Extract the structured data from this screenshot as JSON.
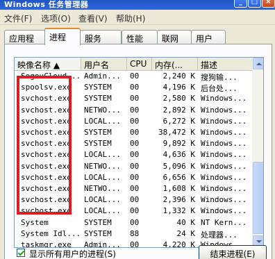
{
  "window": {
    "title": "Windows 任务管理器",
    "buttons": {
      "min": "_",
      "max": "□",
      "close": "×"
    }
  },
  "menu": [
    "文件(F)",
    "选项(O)",
    "查看(V)",
    "帮助(H)"
  ],
  "tabs": [
    {
      "label": "应用程序",
      "active": false
    },
    {
      "label": "进程",
      "active": true
    },
    {
      "label": "服务",
      "active": false
    },
    {
      "label": "性能",
      "active": false
    },
    {
      "label": "联网",
      "active": false
    },
    {
      "label": "用户",
      "active": false
    }
  ],
  "list": {
    "columns": [
      "映像名称 ▲",
      "用户名",
      "CPU",
      "内存(...",
      "描述"
    ],
    "rows": [
      [
        "SogouCloud...",
        "Admin...",
        "00",
        "2,240 K",
        "搜狗输..."
      ],
      [
        "spoolsv.exe",
        "SYSTEM",
        "00",
        "4,196 K",
        "后台处..."
      ],
      [
        "svchost.exe",
        "SYSTEM",
        "00",
        "2,580 K",
        "Windows..."
      ],
      [
        "svchost.exe",
        "NETWO...",
        "00",
        "2,892 K",
        "Windows..."
      ],
      [
        "svchost.exe",
        "LOCAL...",
        "00",
        "6,272 K",
        "Windows..."
      ],
      [
        "svchost.exe",
        "SYSTEM",
        "00",
        "38,472 K",
        "Windows..."
      ],
      [
        "svchost.exe",
        "SYSTEM",
        "00",
        "9,892 K",
        "Windows..."
      ],
      [
        "svchost.exe",
        "LOCAL...",
        "00",
        "4,636 K",
        "Windows..."
      ],
      [
        "svchost.exe",
        "NETWO...",
        "00",
        "5,096 K",
        "Windows..."
      ],
      [
        "svchost.exe",
        "LOCAL...",
        "00",
        "6,656 K",
        "Windows..."
      ],
      [
        "svchost.exe",
        "NETWO...",
        "00",
        "1,608 K",
        "Windows..."
      ],
      [
        "svchost.exe",
        "LOCAL...",
        "00",
        "2,396 K",
        "Windows..."
      ],
      [
        "svchost.exe",
        "LOCAL...",
        "00",
        "1,332 K",
        "Windows..."
      ],
      [
        "System",
        "SYSTEM",
        "00",
        "40 K",
        "NT Kern..."
      ],
      [
        "System Idl...",
        "SYSTEM",
        "88",
        "24 K",
        "处理器..."
      ],
      [
        "taskmgr.exe",
        "Admin...",
        "00",
        "4,220 K",
        "Windows..."
      ]
    ]
  },
  "footer": {
    "show_all_label": "显示所有用户的进程(S)",
    "show_all_checked": true,
    "end_process_label": "结束进程(E)"
  },
  "colors": {
    "highlight": "#d81e22",
    "tab_accent": "#e68b2c",
    "title_bar": "#2f67dc"
  }
}
